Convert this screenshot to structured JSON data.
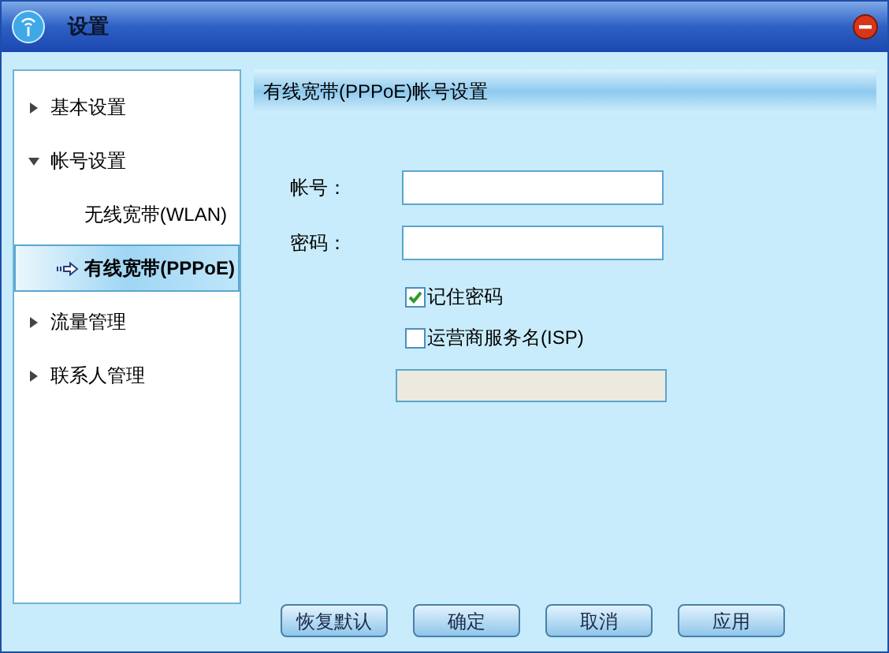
{
  "window": {
    "title": "设置"
  },
  "sidebar": {
    "items": [
      {
        "label": "基本设置",
        "expanded": false
      },
      {
        "label": "帐号设置",
        "expanded": true,
        "children": [
          {
            "label": "无线宽带(WLAN)",
            "selected": false
          },
          {
            "label": "有线宽带(PPPoE)",
            "selected": true
          }
        ]
      },
      {
        "label": "流量管理",
        "expanded": false
      },
      {
        "label": "联系人管理",
        "expanded": false
      }
    ]
  },
  "panel": {
    "title": "有线宽带(PPPoE)帐号设置",
    "fields": [
      {
        "label": "帐号："
      },
      {
        "label": "密码："
      }
    ],
    "checkboxes": [
      {
        "label": "记住密码",
        "checked": true
      },
      {
        "label": "运营商服务名(ISP)",
        "checked": false
      }
    ],
    "isp_field": {
      "disabled": true
    }
  },
  "buttons": [
    "恢复默认",
    "确定",
    "取消",
    "应用"
  ]
}
